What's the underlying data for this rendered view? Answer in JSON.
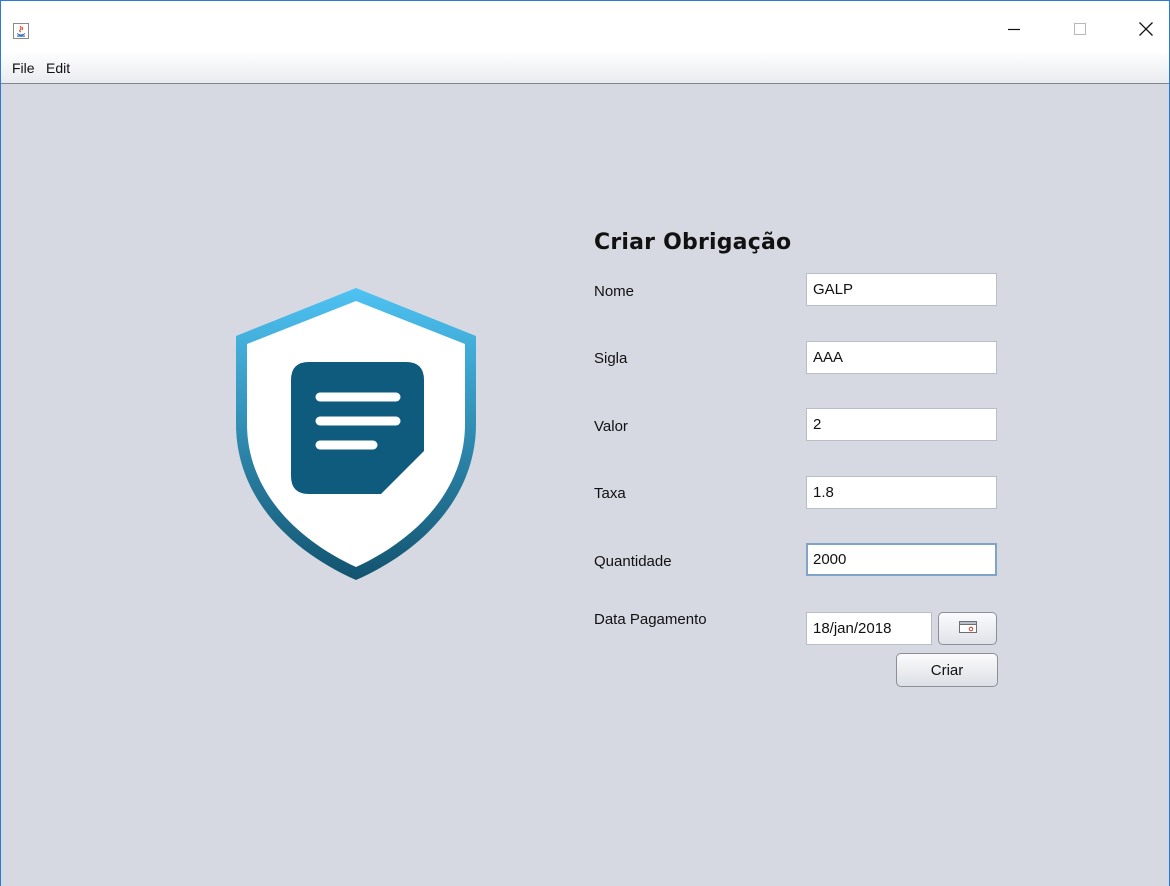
{
  "menu": {
    "file": "File",
    "edit": "Edit"
  },
  "form": {
    "title": "Criar Obrigação",
    "fields": {
      "nome": {
        "label": "Nome",
        "value": "GALP"
      },
      "sigla": {
        "label": "Sigla",
        "value": "AAA"
      },
      "valor": {
        "label": "Valor",
        "value": "2"
      },
      "taxa": {
        "label": "Taxa",
        "value": "1.8"
      },
      "quantidade": {
        "label": "Quantidade",
        "value": "2000"
      },
      "data_pagamento": {
        "label": "Data Pagamento",
        "value": "18/jan/2018"
      }
    },
    "submit_label": "Criar"
  },
  "icons": {
    "app": "java-coffee-icon",
    "logo": "shield-document-icon",
    "calendar": "calendar-icon",
    "minimize": "minimize-icon",
    "maximize": "maximize-icon",
    "close": "close-icon"
  },
  "colors": {
    "shield_gradient_top": "#4ec3f3",
    "shield_gradient_bottom": "#12536f",
    "document": "#0e5b7d",
    "background": "#d6d9e2"
  }
}
